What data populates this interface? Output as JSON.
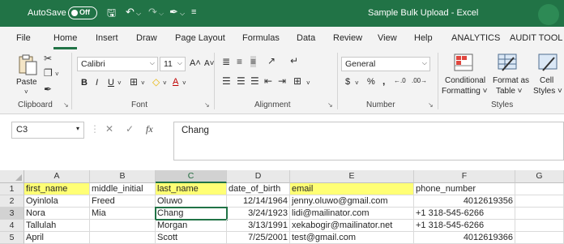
{
  "titlebar": {
    "autosave_label": "AutoSave",
    "autosave_state": "Off",
    "title": "Sample Bulk Upload  -  Excel",
    "qat_icons": [
      "save-icon",
      "undo-icon",
      "redo-icon",
      "brush-icon",
      "customize-icon"
    ]
  },
  "menu": {
    "tabs": [
      "File",
      "Home",
      "Insert",
      "Draw",
      "Page Layout",
      "Formulas",
      "Data",
      "Review",
      "View",
      "Help",
      "ANALYTICS",
      "AUDIT TOOL"
    ],
    "active": "Home"
  },
  "ribbon": {
    "clipboard": {
      "label": "Clipboard",
      "paste": "Paste"
    },
    "font": {
      "label": "Font",
      "name": "Calibri",
      "size": "11"
    },
    "alignment": {
      "label": "Alignment"
    },
    "number": {
      "label": "Number",
      "format": "General"
    },
    "styles": {
      "label": "Styles",
      "conditional_line1": "Conditional",
      "conditional_line2": "Formatting ˅",
      "format_as_line1": "Format as",
      "format_as_line2": "Table ˅",
      "cell_line1": "Cell",
      "cell_line2": "Styles ˅"
    }
  },
  "formula_bar": {
    "name_box": "C3",
    "fx": "fx",
    "value": "Chang"
  },
  "sheet": {
    "columns": [
      "A",
      "B",
      "C",
      "D",
      "E",
      "F",
      "G"
    ],
    "row_numbers": [
      "1",
      "2",
      "3",
      "4",
      "5"
    ],
    "rows": [
      [
        "first_name",
        "middle_initial",
        "last_name",
        "date_of_birth",
        "email",
        "phone_number",
        ""
      ],
      [
        "Oyinlola",
        "Freed",
        "Oluwo",
        "12/14/1964",
        "jenny.oluwo@gmail.com",
        "4012619356",
        ""
      ],
      [
        "Nora",
        "Mia",
        "Chang",
        "3/24/1923",
        "lidi@mailinator.com",
        "+1 318-545-6266",
        ""
      ],
      [
        "Tallulah",
        "",
        "Morgan",
        "3/13/1991",
        "xekabogir@mailinator.net",
        "+1 318-545-6266",
        ""
      ],
      [
        "April",
        "",
        "Scott",
        "7/25/2001",
        "test@gmail.com",
        "4012619366",
        ""
      ]
    ],
    "highlight_color": "#ffff75",
    "accent": "#217346"
  }
}
